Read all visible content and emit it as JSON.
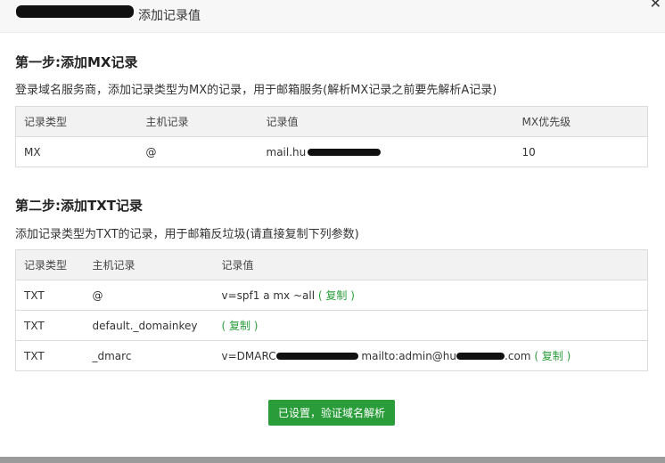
{
  "header": {
    "title": "添加记录值"
  },
  "step1": {
    "title": "第一步:添加MX记录",
    "description": "登录域名服务商，添加记录类型为MX的记录，用于邮箱服务(解析MX记录之前要先解析A记录)",
    "columns": [
      "记录类型",
      "主机记录",
      "记录值",
      "MX优先级"
    ],
    "row": {
      "type": "MX",
      "host": "@",
      "value": "mail.hu",
      "priority": "10"
    }
  },
  "step2": {
    "title": "第二步:添加TXT记录",
    "description": "添加记录类型为TXT的记录，用于邮箱反垃圾(请直接复制下列参数)",
    "columns": [
      "记录类型",
      "主机记录",
      "记录值"
    ],
    "rows": [
      {
        "type": "TXT",
        "host": "@",
        "value": "v=spf1 a mx ~all"
      },
      {
        "type": "TXT",
        "host": "default._domainkey",
        "value": ""
      },
      {
        "type": "TXT",
        "host": "_dmarc",
        "value_prefix": "v=DMARC",
        "value_mid": "mailto:admin@hu",
        "value_suffix": ".com"
      }
    ],
    "copy_label": "( 复制 )"
  },
  "verify_button": "已设置，验证域名解析",
  "colors": {
    "accent": "#2a9d3a",
    "header_bg": "#f7f7f7"
  }
}
